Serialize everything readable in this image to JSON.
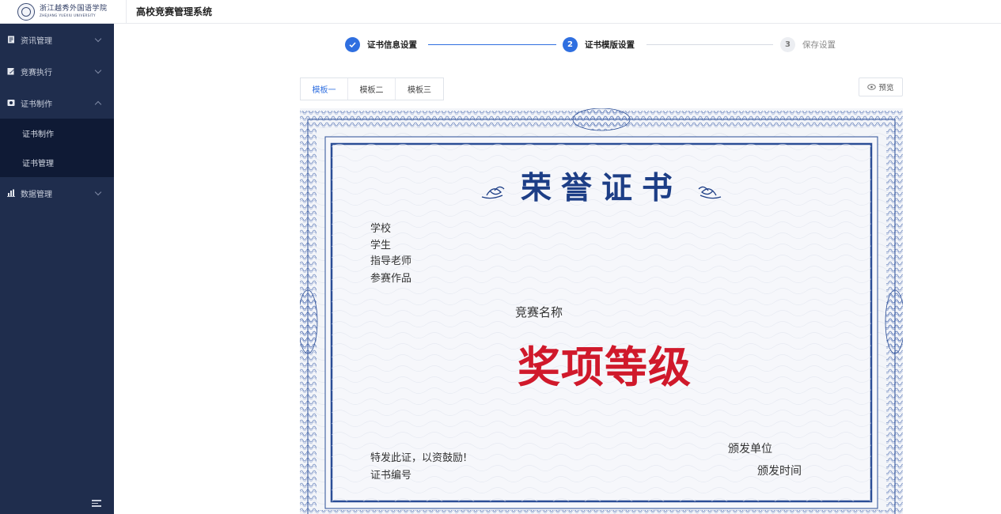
{
  "header": {
    "logo_cn": "浙江越秀外国语学院",
    "logo_en": "ZHEJIANG YUEXIU UNIVERSITY",
    "app_title": "高校竞赛管理系统"
  },
  "sidebar": {
    "items": [
      {
        "label": "资讯管理",
        "icon": "news-icon",
        "expanded": false
      },
      {
        "label": "竞赛执行",
        "icon": "edit-doc-icon",
        "expanded": false
      },
      {
        "label": "证书制作",
        "icon": "certificate-icon",
        "expanded": true,
        "children": [
          {
            "label": "证书制作"
          },
          {
            "label": "证书管理"
          }
        ]
      },
      {
        "label": "数据管理",
        "icon": "bar-chart-icon",
        "expanded": false
      }
    ],
    "collapse_icon": "menu-collapse-icon"
  },
  "steps": [
    {
      "number": "",
      "label": "证书信息设置",
      "status": "done"
    },
    {
      "number": "2",
      "label": "证书模版设置",
      "status": "active"
    },
    {
      "number": "3",
      "label": "保存设置",
      "status": "pending"
    }
  ],
  "tabs": [
    {
      "label": "模板一",
      "active": true
    },
    {
      "label": "模板二",
      "active": false
    },
    {
      "label": "模板三",
      "active": false
    }
  ],
  "preview_button": {
    "label": "预览",
    "icon": "eye-icon"
  },
  "certificate": {
    "title": "荣誉证书",
    "school": "学校",
    "student": "学生",
    "teacher": "指导老师",
    "work": "参赛作品",
    "competition": "竞赛名称",
    "award": "奖项等级",
    "encourage": "特发此证，以资鼓励!",
    "number": "证书编号",
    "issuer": "颁发单位",
    "issue_time": "颁发时间",
    "colors": {
      "title": "#1d3e86",
      "award": "#d0192b",
      "border": "#2a4d96"
    }
  }
}
